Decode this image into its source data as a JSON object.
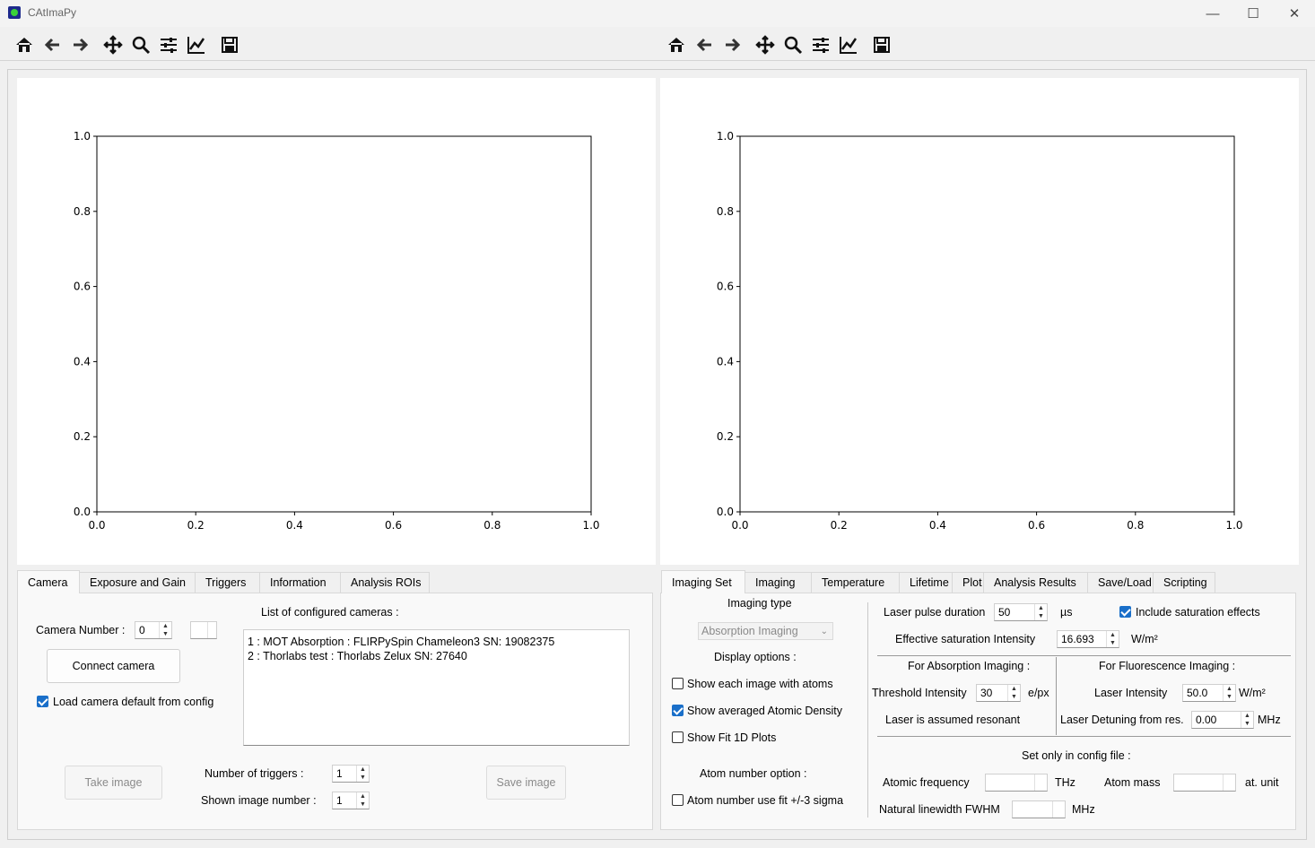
{
  "window": {
    "title": "CAtImaPy",
    "minimize": "—",
    "maximize": "☐",
    "close": "✕"
  },
  "toolbar_icons": [
    "home-icon",
    "back-icon",
    "forward-icon",
    "pan-icon",
    "zoom-icon",
    "configure-subplots-icon",
    "edit-axis-icon",
    "save-figure-icon"
  ],
  "plots": {
    "left": {
      "xticks": [
        "0.0",
        "0.2",
        "0.4",
        "0.6",
        "0.8",
        "1.0"
      ],
      "yticks": [
        "0.0",
        "0.2",
        "0.4",
        "0.6",
        "0.8",
        "1.0"
      ]
    },
    "right": {
      "xticks": [
        "0.0",
        "0.2",
        "0.4",
        "0.6",
        "0.8",
        "1.0"
      ],
      "yticks": [
        "0.0",
        "0.2",
        "0.4",
        "0.6",
        "0.8",
        "1.0"
      ]
    }
  },
  "left_panel": {
    "tabs": [
      "Camera",
      "Exposure and Gain",
      "Triggers",
      "Information",
      "Analysis ROIs"
    ],
    "camera_number_label": "Camera Number :",
    "camera_number_value": "0",
    "connect_button": "Connect camera",
    "load_default_label": "Load camera default from config",
    "cameras_list_label": "List of configured cameras :",
    "cameras": [
      "1 : MOT Absorption : FLIRPySpin Chameleon3 SN: 19082375",
      "2 : Thorlabs test : Thorlabs Zelux SN: 27640"
    ],
    "take_image_button": "Take image",
    "num_triggers_label": "Number of triggers :",
    "num_triggers_value": "1",
    "shown_image_label": "Shown image number :",
    "shown_image_value": "1",
    "save_image_button": "Save image"
  },
  "right_panel": {
    "tabs": [
      "Imaging Set",
      "Imaging",
      "Temperature",
      "Lifetime",
      "Plot",
      "Analysis Results",
      "Save/Load",
      "Scripting"
    ],
    "imaging_type_label": "Imaging type",
    "imaging_type_value": "Absorption Imaging",
    "display_options_label": "Display options :",
    "show_each_image": "Show each image with atoms",
    "show_averaged": "Show averaged Atomic Density",
    "show_fit_1d": "Show Fit 1D Plots",
    "atom_number_option_label": "Atom number option :",
    "atom_number_fit": "Atom number use fit +/-3 sigma",
    "laser_pulse_label": "Laser pulse duration",
    "laser_pulse_value": "50",
    "laser_pulse_unit": "µs",
    "include_saturation": "Include saturation effects",
    "eff_sat_label": "Effective saturation Intensity",
    "eff_sat_value": "16.693",
    "eff_sat_unit": "W/m²",
    "absorption_header": "For Absorption Imaging :",
    "fluorescence_header": "For Fluorescence Imaging :",
    "threshold_label": "Threshold Intensity",
    "threshold_value": "30",
    "threshold_unit": "e/px",
    "laser_intensity_label": "Laser Intensity",
    "laser_intensity_value": "50.0",
    "laser_intensity_unit": "W/m²",
    "resonant_label": "Laser is assumed resonant",
    "detuning_label": "Laser Detuning from res.",
    "detuning_value": "0.00",
    "detuning_unit": "MHz",
    "config_only_label": "Set only in config file :",
    "atomic_freq_label": "Atomic frequency",
    "atomic_freq_unit": "THz",
    "atom_mass_label": "Atom mass",
    "atom_mass_unit": "at. unit",
    "linewidth_label": "Natural linewidth FWHM",
    "linewidth_unit": "MHz"
  },
  "colors": {
    "checkbox_accent": "#1a6fc9",
    "window_bg": "#f0f0f0",
    "pane_bg": "#f9f9f9"
  }
}
